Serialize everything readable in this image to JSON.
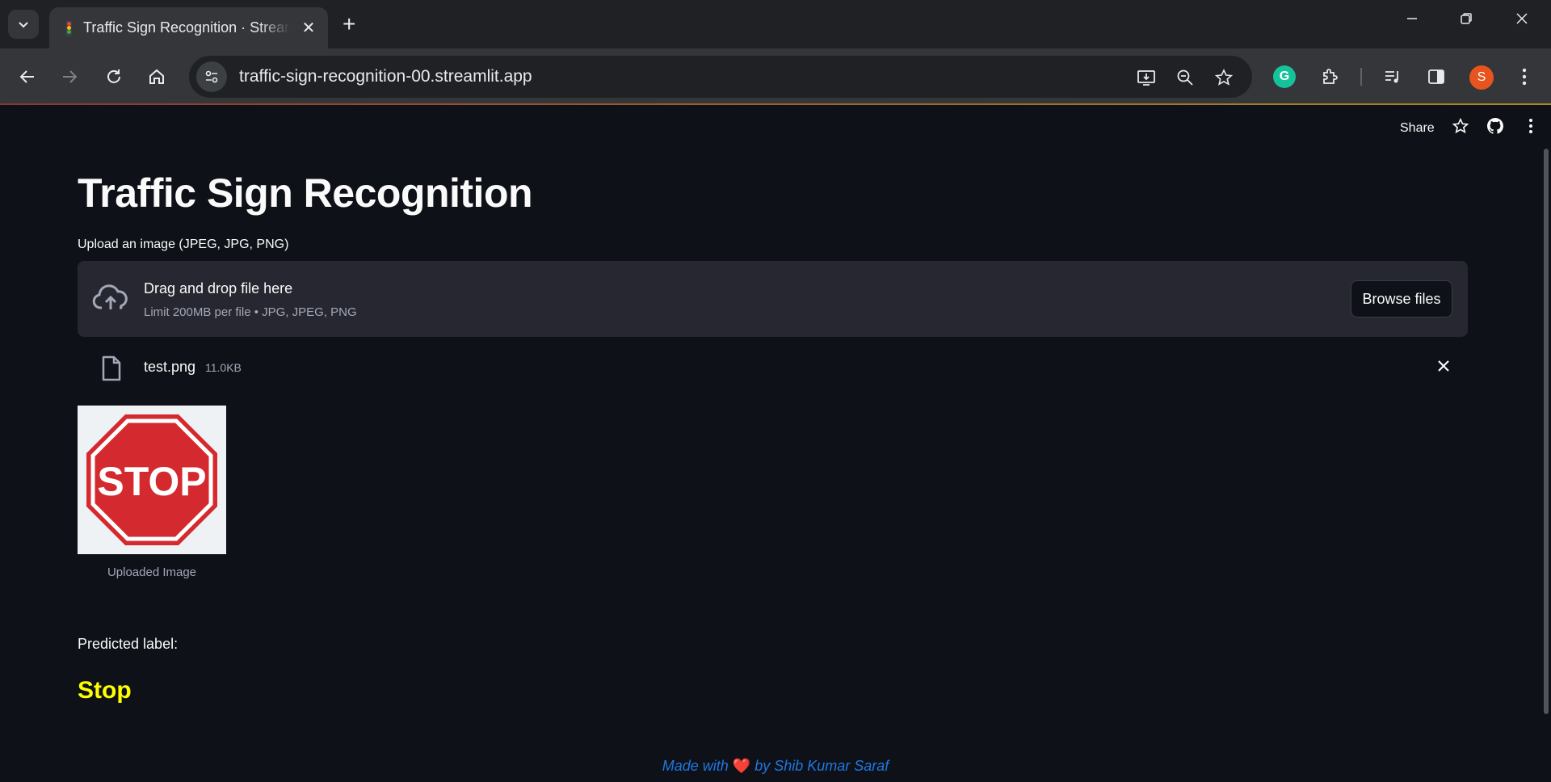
{
  "browser": {
    "tab_title": "Traffic Sign Recognition · Streamlit",
    "url": "traffic-sign-recognition-00.streamlit.app",
    "avatar_initial": "S",
    "grammarly_letter": "G"
  },
  "app": {
    "header": {
      "share_label": "Share"
    },
    "title": "Traffic Sign Recognition",
    "uploader": {
      "label": "Upload an image (JPEG, JPG, PNG)",
      "drop_title": "Drag and drop file here",
      "drop_subtitle": "Limit 200MB per file • JPG, JPEG, PNG",
      "browse_label": "Browse files"
    },
    "file": {
      "name": "test.png",
      "size": "11.0KB"
    },
    "image": {
      "sign_text": "STOP",
      "caption": "Uploaded Image"
    },
    "prediction": {
      "label": "Predicted label:",
      "value": "Stop",
      "value_color": "#ffff00"
    },
    "footer": {
      "prefix": "Made with",
      "suffix": "by Shib Kumar Saraf"
    }
  },
  "icons": {
    "tab_search": "chevron-down-icon",
    "back": "arrow-left-icon",
    "forward": "arrow-right-icon",
    "reload": "reload-icon",
    "home": "home-icon",
    "site_info": "tune-icon",
    "install": "install-app-icon",
    "zoom": "zoom-out-icon",
    "bookmark": "star-icon",
    "extensions": "puzzle-icon",
    "media": "media-queue-icon",
    "side_panel": "side-panel-icon",
    "menu": "kebab-menu-icon",
    "github": "github-icon",
    "upload": "cloud-upload-icon",
    "file": "file-icon",
    "close": "close-icon",
    "heart": "heart-icon"
  }
}
